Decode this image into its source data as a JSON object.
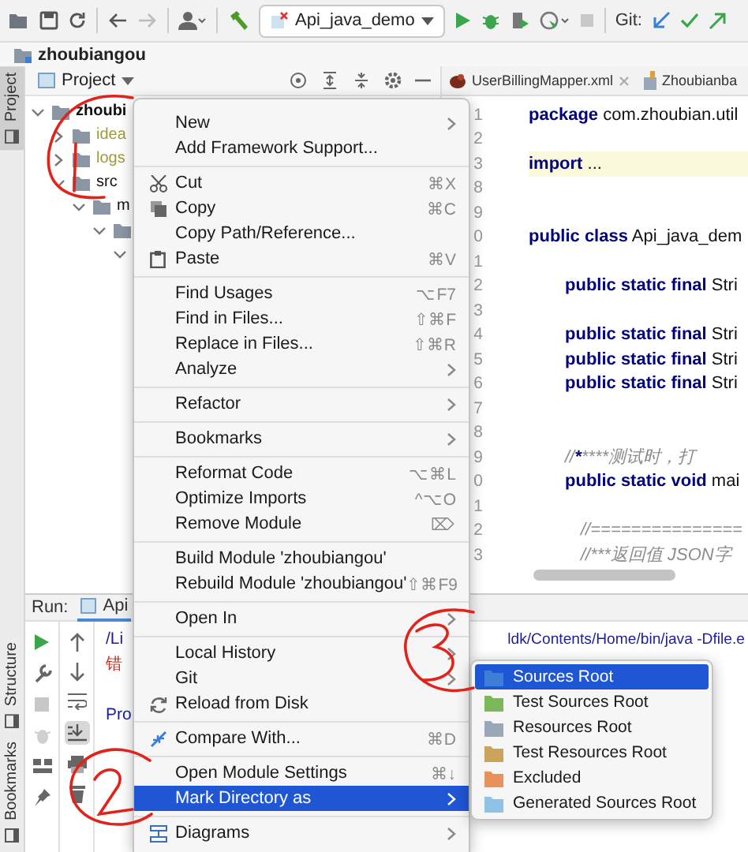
{
  "toolbar": {
    "run_config": "Api_java_demo",
    "git_label": "Git:"
  },
  "breadcrumb": "zhoubiangou",
  "side_tabs": [
    {
      "label": "Project",
      "kind": "top",
      "selected": true
    },
    {
      "label": "Structure",
      "kind": "bottom",
      "selected": false
    },
    {
      "label": "Bookmarks",
      "kind": "bottom",
      "selected": false
    }
  ],
  "project_panel": {
    "title": "Project",
    "tree": [
      {
        "label": "zhoubi",
        "root": true,
        "ignored": false,
        "expanded": true,
        "children": [
          {
            "label": "idea",
            "ignored": true,
            "expanded": false
          },
          {
            "label": "logs",
            "ignored": true,
            "expanded": false
          },
          {
            "label": "src",
            "ignored": false,
            "expanded": true,
            "children": [
              {
                "label": "m",
                "ignored": false,
                "expanded": true,
                "children": [
                  {
                    "expanded": true,
                    "children": [
                      {
                        "expanded": true
                      }
                    ]
                  }
                ]
              }
            ]
          }
        ]
      }
    ]
  },
  "editor": {
    "tabs": [
      {
        "label": "UserBillingMapper.xml",
        "closable": true,
        "selected": false
      },
      {
        "label": "Zhoubianba",
        "closable": false,
        "selected": false
      }
    ],
    "lines": [
      {
        "number": "1",
        "kind": "top",
        "code": "**package** com.zhoubian.util",
        "current": false
      },
      {
        "number": "2",
        "current": false
      },
      {
        "number": "3",
        "kind": "top",
        "code": "**import** ...",
        "current": true
      },
      {
        "number": "8",
        "current": false
      },
      {
        "number": "9",
        "current": false
      },
      {
        "number": "0",
        "kind": "top",
        "code": "**public class** Api_java_dem",
        "current": false
      },
      {
        "number": "1",
        "current": false
      },
      {
        "number": "2",
        "kind": "member",
        "code": "**public static final** Stri",
        "current": false
      },
      {
        "number": "3",
        "current": false
      },
      {
        "number": "4",
        "kind": "member",
        "code": "**public static final** Stri",
        "current": false
      },
      {
        "number": "5",
        "kind": "member",
        "code": "**public static final** Stri",
        "current": false
      },
      {
        "number": "6",
        "kind": "member",
        "code": "**public static final** Stri",
        "current": false
      },
      {
        "number": "7",
        "current": false
      },
      {
        "number": "8",
        "current": false
      },
      {
        "number": "9",
        "kind": "comment",
        "code": "//*********测试时，打",
        "current": false
      },
      {
        "number": "0",
        "kind": "member",
        "code": "**public static void** mai",
        "current": false
      },
      {
        "number": "1",
        "current": false
      },
      {
        "number": "2",
        "kind": "inner-comment",
        "code": "//===============",
        "current": false
      },
      {
        "number": "3",
        "kind": "inner-comment",
        "code": "//***返回值 JSON字",
        "current": false
      }
    ]
  },
  "run_panel": {
    "label": "Run:",
    "tab": "Api",
    "console": [
      {
        "kind": "command",
        "left": "/Li",
        "right": "ldk/Contents/Home/bin/java -Dfile.e"
      },
      {
        "kind": "error",
        "left": "错"
      },
      {
        "kind": "blank"
      },
      {
        "kind": "command",
        "left": "Pro"
      }
    ]
  },
  "context_menu": {
    "sections": [
      [
        {
          "label": "New",
          "kind": "plain",
          "submenu": true,
          "selected": false
        },
        {
          "label": "Add Framework Support...",
          "kind": "plain",
          "submenu": false,
          "selected": false
        }
      ],
      [
        {
          "label": "Cut",
          "kind": "cut",
          "shortcut": "⌘X",
          "submenu": false,
          "selected": false
        },
        {
          "label": "Copy",
          "kind": "copy",
          "shortcut": "⌘C",
          "submenu": false,
          "selected": false
        },
        {
          "label": "Copy Path/Reference...",
          "kind": "plain",
          "submenu": false,
          "selected": false
        },
        {
          "label": "Paste",
          "kind": "paste",
          "shortcut": "⌘V",
          "submenu": false,
          "selected": false
        }
      ],
      [
        {
          "label": "Find Usages",
          "kind": "plain",
          "shortcut": "⌥F7",
          "submenu": false,
          "selected": false
        },
        {
          "label": "Find in Files...",
          "kind": "plain",
          "shortcut": "⇧⌘F",
          "submenu": false,
          "selected": false
        },
        {
          "label": "Replace in Files...",
          "kind": "plain",
          "shortcut": "⇧⌘R",
          "submenu": false,
          "selected": false
        },
        {
          "label": "Analyze",
          "kind": "plain",
          "submenu": true,
          "selected": false
        }
      ],
      [
        {
          "label": "Refactor",
          "kind": "plain",
          "submenu": true,
          "selected": false
        }
      ],
      [
        {
          "label": "Bookmarks",
          "kind": "plain",
          "submenu": true,
          "selected": false
        }
      ],
      [
        {
          "label": "Reformat Code",
          "kind": "plain",
          "shortcut": "⌥⌘L",
          "submenu": false,
          "selected": false
        },
        {
          "label": "Optimize Imports",
          "kind": "plain",
          "shortcut": "^⌥O",
          "submenu": false,
          "selected": false
        },
        {
          "label": "Remove Module",
          "kind": "plain",
          "shortcut": "⌦",
          "submenu": false,
          "selected": false
        }
      ],
      [
        {
          "label": "Build Module 'zhoubiangou'",
          "kind": "plain",
          "submenu": false,
          "selected": false
        },
        {
          "label": "Rebuild Module 'zhoubiangou'",
          "kind": "plain",
          "shortcut": "⇧⌘F9",
          "submenu": false,
          "selected": false
        }
      ],
      [
        {
          "label": "Open In",
          "kind": "plain",
          "submenu": true,
          "selected": false
        }
      ],
      [
        {
          "label": "Local History",
          "kind": "plain",
          "submenu": true,
          "selected": false
        },
        {
          "label": "Git",
          "kind": "plain",
          "submenu": true,
          "selected": false
        },
        {
          "label": "Reload from Disk",
          "kind": "reload",
          "submenu": false,
          "selected": false
        }
      ],
      [
        {
          "label": "Compare With...",
          "kind": "compare",
          "shortcut": "⌘D",
          "submenu": false,
          "selected": false
        }
      ],
      [
        {
          "label": "Open Module Settings",
          "kind": "plain",
          "shortcut": "⌘↓",
          "submenu": false,
          "selected": false
        },
        {
          "label": "Mark Directory as",
          "kind": "plain",
          "submenu": true,
          "selected": true
        }
      ],
      [
        {
          "label": "Diagrams",
          "kind": "diagrams",
          "submenu": true,
          "selected": false
        }
      ]
    ]
  },
  "submenu": {
    "items": [
      {
        "label": "Sources Root",
        "color": "#3d7fd6",
        "selected": true
      },
      {
        "label": "Test Sources Root",
        "color": "#7cb85a",
        "selected": false
      },
      {
        "label": "Resources Root",
        "color": "#9aa7b8",
        "selected": false
      },
      {
        "label": "Test Resources Root",
        "color": "#c9a45a",
        "selected": false
      },
      {
        "label": "Excluded",
        "color": "#e8915a",
        "selected": false
      },
      {
        "label": "Generated Sources Root",
        "color": "#8ec3e6",
        "selected": false
      }
    ]
  }
}
